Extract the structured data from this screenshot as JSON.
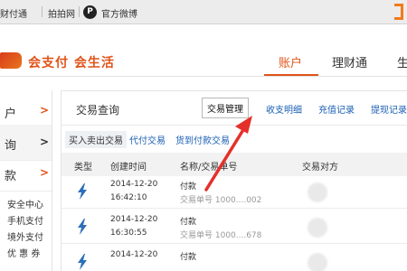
{
  "topbar": {
    "links": [
      "财付通",
      "拍拍网",
      "官方微博"
    ],
    "weibo_icon_glyph": "P"
  },
  "header": {
    "slogan": "会支付 会生活",
    "nav": [
      "账户",
      "理财通",
      "生"
    ],
    "active_nav_index": 0
  },
  "sidebar": {
    "items": [
      {
        "label": "户",
        "chev": ">"
      },
      {
        "label": "询",
        "chev": ">"
      },
      {
        "label": "款",
        "chev": ">"
      }
    ],
    "active_index": 1,
    "subitems": [
      "安全中心",
      "手机支付",
      "境外支付",
      "优 惠 券"
    ]
  },
  "panel": {
    "title": "交易查询",
    "tabs": [
      "交易管理",
      "收支明细",
      "充值记录",
      "提现记录"
    ],
    "active_tab_index": 0,
    "subtabs": [
      "买入卖出交易",
      "代付交易",
      "货到付款交易"
    ],
    "active_subtab_index": 0,
    "columns": [
      "类型",
      "创建时间",
      "名称/交易单号",
      "交易对方"
    ],
    "rows": [
      {
        "date": "2014-12-20",
        "time": "16:42:10",
        "name": "付款",
        "order": "交易单号 1000....002"
      },
      {
        "date": "2014-12-20",
        "time": "16:30:55",
        "name": "付款",
        "order": "交易单号 1000....678"
      },
      {
        "date": "2014-12-20",
        "time": "",
        "name": "付款",
        "order": ""
      }
    ]
  },
  "colors": {
    "accent": "#e0541a",
    "link": "#1a5fb4",
    "annotation": "#e5302a",
    "bolt": "#2c6fb8"
  },
  "icons": {
    "row_type": "lightning-bolt-icon",
    "weibo": "weibo-p-icon"
  }
}
